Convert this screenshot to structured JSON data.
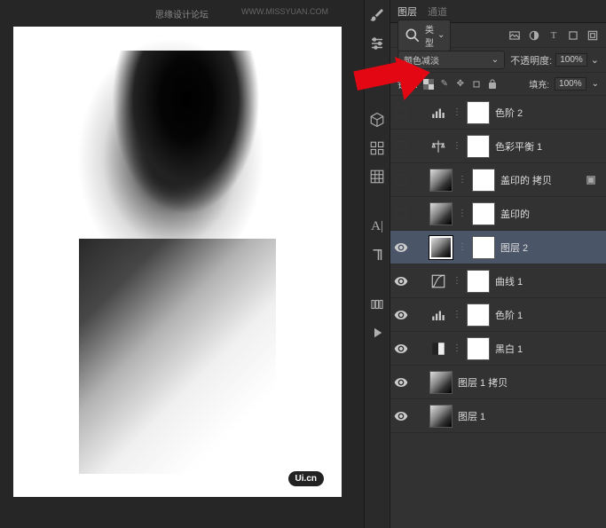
{
  "watermark": {
    "top": "思缘设计论坛",
    "url": "WWW.MISSYUAN.COM"
  },
  "ui_badge": "Ui.cn",
  "panel": {
    "tabs": [
      "图层",
      "通道"
    ],
    "filter_label": "类型",
    "blend_mode": "颜色减淡",
    "opacity_label": "不透明度:",
    "opacity_value": "100%",
    "lock_label": "锁定:",
    "fill_label": "填充:",
    "fill_value": "100%"
  },
  "layers": [
    {
      "visible": false,
      "type": "adj",
      "adj_icon": "levels",
      "name": "色阶 2"
    },
    {
      "visible": false,
      "type": "adj",
      "adj_icon": "balance",
      "name": "色彩平衡 1"
    },
    {
      "visible": false,
      "type": "img",
      "name": "盖印的 拷贝",
      "fx": true
    },
    {
      "visible": false,
      "type": "img",
      "name": "盖印的"
    },
    {
      "visible": true,
      "type": "img",
      "name": "图层 2",
      "selected": true
    },
    {
      "visible": true,
      "type": "adj",
      "adj_icon": "curves",
      "name": "曲线 1"
    },
    {
      "visible": true,
      "type": "adj",
      "adj_icon": "levels",
      "name": "色阶 1"
    },
    {
      "visible": true,
      "type": "adj",
      "adj_icon": "bw",
      "name": "黑白 1"
    },
    {
      "visible": true,
      "type": "img",
      "name": "图层 1 拷贝",
      "no_mask": true
    },
    {
      "visible": true,
      "type": "img",
      "name": "图层 1",
      "no_mask": true
    }
  ]
}
